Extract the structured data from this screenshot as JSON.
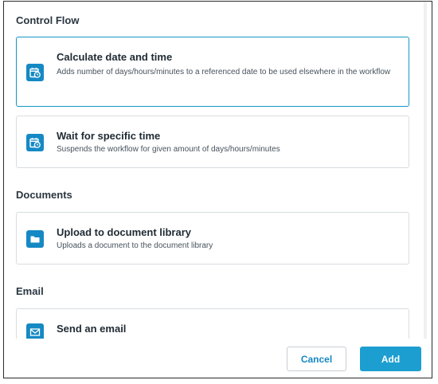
{
  "sections": [
    {
      "title": "Control Flow"
    },
    {
      "title": "Documents"
    },
    {
      "title": "Email"
    }
  ],
  "cards": [
    {
      "title": "Calculate date and time",
      "description": "Adds number of days/hours/minutes to a referenced date to be used elsewhere in the workflow",
      "icon": "calendar-clock-icon",
      "selected": true
    },
    {
      "title": "Wait for specific time",
      "description": "Suspends the workflow for given amount of days/hours/minutes",
      "icon": "calendar-clock-icon",
      "selected": false
    },
    {
      "title": "Upload to document library",
      "description": "Uploads a document to the document library",
      "icon": "folder-icon",
      "selected": false
    },
    {
      "title": "Send an email",
      "description": "",
      "icon": "envelope-icon",
      "selected": false
    }
  ],
  "footer": {
    "cancel_label": "Cancel",
    "add_label": "Add"
  },
  "colors": {
    "accent": "#1d9ed1",
    "icon_bg": "#1589c4",
    "selected_border": "#1496c6"
  }
}
